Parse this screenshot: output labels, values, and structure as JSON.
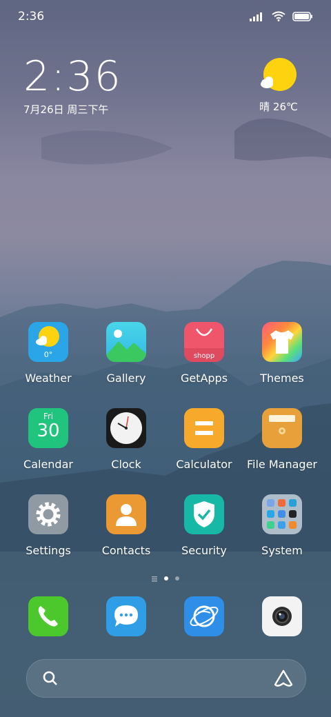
{
  "status_bar": {
    "time": "2:36",
    "icons": [
      "signal-icon",
      "wifi-icon",
      "battery-icon"
    ]
  },
  "clock_widget": {
    "time": "2:36",
    "date": "7月26日 周三下午"
  },
  "weather_widget": {
    "condition": "晴",
    "temperature": "26℃",
    "icon": "sun-cloud-icon"
  },
  "apps": [
    {
      "id": "weather",
      "label": "Weather",
      "icon": "weather-icon",
      "badge_text": "0°"
    },
    {
      "id": "gallery",
      "label": "Gallery",
      "icon": "gallery-icon"
    },
    {
      "id": "getapps",
      "label": "GetApps",
      "icon": "shopping-bag-icon",
      "badge_text": "shopp"
    },
    {
      "id": "themes",
      "label": "Themes",
      "icon": "tshirt-icon"
    },
    {
      "id": "calendar",
      "label": "Calendar",
      "icon": "calendar-icon",
      "day_name": "Fri",
      "day_number": "30"
    },
    {
      "id": "clock",
      "label": "Clock",
      "icon": "clock-icon"
    },
    {
      "id": "calculator",
      "label": "Calculator",
      "icon": "calculator-icon"
    },
    {
      "id": "file-manager",
      "label": "File Manager",
      "icon": "folder-icon"
    },
    {
      "id": "settings",
      "label": "Settings",
      "icon": "gear-icon"
    },
    {
      "id": "contacts",
      "label": "Contacts",
      "icon": "person-icon"
    },
    {
      "id": "security",
      "label": "Security",
      "icon": "shield-check-icon"
    },
    {
      "id": "system",
      "label": "System",
      "icon": "folder-grid-icon"
    }
  ],
  "page_indicator": {
    "pages": 2,
    "current": 1
  },
  "dock": [
    {
      "id": "phone",
      "icon": "phone-icon"
    },
    {
      "id": "messages",
      "icon": "chat-bubble-icon"
    },
    {
      "id": "browser",
      "icon": "globe-icon"
    },
    {
      "id": "camera",
      "icon": "camera-icon"
    }
  ],
  "search_bar": {
    "left_icon": "search-icon",
    "right_icon": "assistant-icon"
  },
  "colors": {
    "weather": "#2aa6e8",
    "gallery": "#3ec9d6",
    "getapps": "#f0566b",
    "calendar": "#20c47c",
    "clock": "#1a1a1a",
    "calculator": "#f7a92b",
    "file_manager": "#e8a03a",
    "settings": "#8f9aa3",
    "contacts": "#eb9a33",
    "security": "#17b8a6",
    "phone": "#4cc82c",
    "messages": "#2f9ee6",
    "browser": "#2f8ee8",
    "camera": "#f3f3f3"
  }
}
